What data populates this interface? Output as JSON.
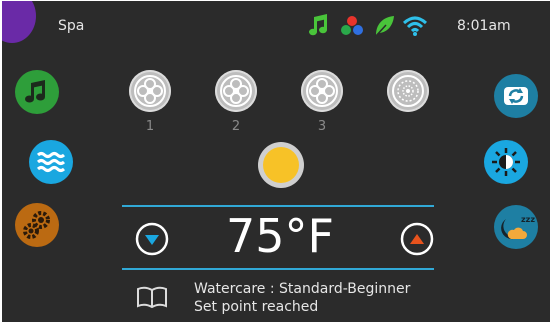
{
  "header": {
    "title": "Spa",
    "clock": "8:01am",
    "status_icons": [
      "music-note-icon",
      "color-lights-icon",
      "leaf-icon",
      "wifi-icon"
    ]
  },
  "left_nav": {
    "items": [
      {
        "name": "audio-button",
        "icon": "music-note-icon",
        "color": "#2e9e3a"
      },
      {
        "name": "jets-button",
        "icon": "water-waves-icon",
        "color": "#1aa7e0"
      },
      {
        "name": "settings-button",
        "icon": "gears-icon",
        "color": "#bb6a12"
      }
    ]
  },
  "right_nav": {
    "items": [
      {
        "name": "invert-button",
        "icon": "rotate-icon",
        "color": "#1e7fa3"
      },
      {
        "name": "brightness-button",
        "icon": "brightness-icon",
        "color": "#1aa7e0"
      },
      {
        "name": "sleep-button",
        "icon": "sleep-moon-icon",
        "color": "#1e7fa3"
      }
    ]
  },
  "pumps": [
    {
      "label": "1"
    },
    {
      "label": "2"
    },
    {
      "label": "3"
    },
    {
      "label": ""
    }
  ],
  "light": {
    "color": "#f7c227"
  },
  "temperature": {
    "value": "75°F"
  },
  "status": {
    "watercare": "Watercare : Standard-Beginner",
    "message": "Set point reached"
  },
  "colors": {
    "background": "#2b2b2b",
    "accent_blue": "#31a9d6",
    "down_arrow": "#1aa7e0",
    "up_arrow": "#e8531d"
  }
}
